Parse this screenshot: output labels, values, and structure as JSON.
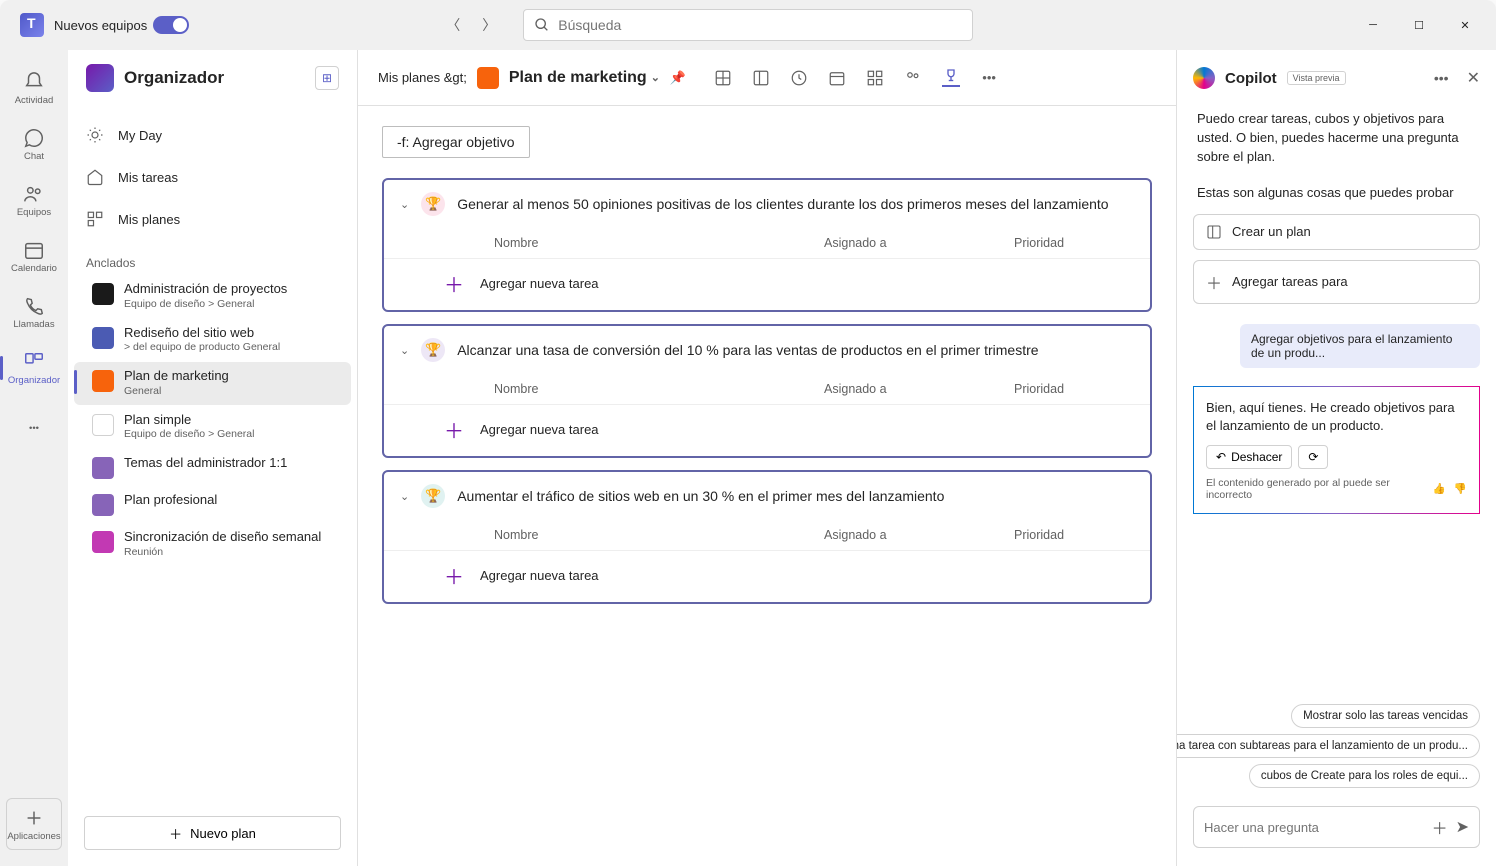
{
  "titlebar": {
    "toggle_label": "Nuevos equipos",
    "search_placeholder": "Búsqueda"
  },
  "rail": {
    "activity": "Actividad",
    "chat": "Chat",
    "teams": "Equipos",
    "calendar": "Calendario",
    "calls": "Llamadas",
    "planner": "Organizador",
    "apps": "Aplicaciones"
  },
  "sidebar": {
    "title": "Organizador",
    "nav": {
      "myday": "My Day",
      "mytasks": "Mis tareas",
      "myplans": "Mis planes"
    },
    "pinned_label": "Anclados",
    "pins": [
      {
        "name": "Administración de proyectos",
        "sub": "Equipo de diseño &gt;   General",
        "color": "#1a1a1a"
      },
      {
        "name": "Rediseño del sitio web",
        "sub": "&gt; del equipo de producto   General",
        "color": "#4b5bb3"
      },
      {
        "name": "Plan de marketing",
        "sub": "General",
        "color": "#f7630c",
        "active": true
      },
      {
        "name": "Plan simple",
        "sub": "Equipo de diseño &gt;   General",
        "color": "#fff",
        "bordered": true
      },
      {
        "name": "Temas del administrador 1:1",
        "sub": "",
        "color": "#8764b8"
      },
      {
        "name": "Plan profesional",
        "sub": "",
        "color": "#8764b8"
      },
      {
        "name": "Sincronización de diseño semanal",
        "sub": "Reunión",
        "color": "#c239b3"
      }
    ],
    "new_plan": "Nuevo plan"
  },
  "main": {
    "breadcrumb": "Mis planes &gt;",
    "plan_title": "Plan de marketing",
    "add_goal": "-f: Agregar objetivo",
    "cols": {
      "name": "Nombre",
      "assigned": "Asignado a",
      "priority": "Prioridad"
    },
    "add_task": "Agregar nueva tarea",
    "goals": [
      {
        "cls": "g-pink",
        "title": "Generar al menos 50 opiniones positivas de los clientes durante los dos primeros meses del lanzamiento"
      },
      {
        "cls": "g-purple",
        "title": "Alcanzar una tasa de conversión del 10 % para las ventas de productos en el primer trimestre"
      },
      {
        "cls": "g-teal",
        "title": "Aumentar el tráfico de sitios web en un 30 % en el primer mes del lanzamiento"
      }
    ]
  },
  "copilot": {
    "title": "Copilot",
    "badge": "Vista previa",
    "intro1": "Puedo crear tareas, cubos y objetivos para usted. O bien, puedes hacerme una pregunta sobre el plan.",
    "intro2": "Estas son algunas cosas que puedes probar",
    "action_plan": "Crear un plan",
    "action_tasks": "Agregar tareas para",
    "user_msg": "Agregar objetivos para el lanzamiento de un produ...",
    "response": "Bien, aquí tienes. He creado objetivos para el lanzamiento de un producto.",
    "undo": "Deshacer",
    "disclaimer": "El contenido generado por al puede ser incorrecto",
    "sugg1": "Mostrar solo las tareas vencidas",
    "sugg2": "Agregar una tarea con subtareas para el lanzamiento de un produ...",
    "sugg3": "cubos de Create para los roles de equi...",
    "input_placeholder": "Hacer una pregunta"
  }
}
